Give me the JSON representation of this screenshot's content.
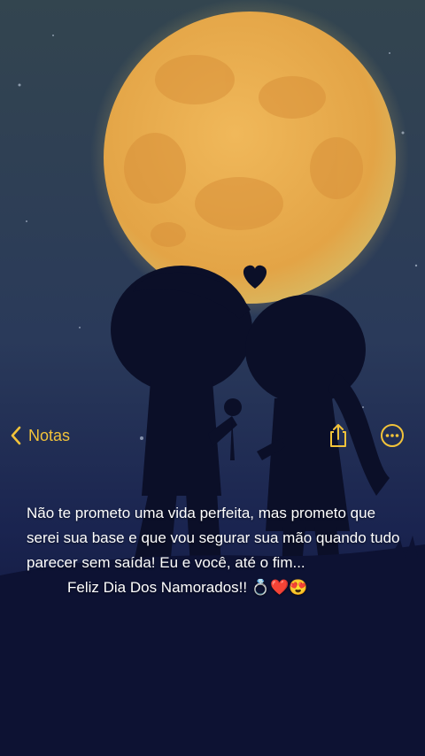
{
  "nav": {
    "back_label": "Notas",
    "back_icon": "chevron-left-icon",
    "share_icon": "share-icon",
    "more_icon": "more-circle-icon",
    "accent_color": "#f2c33a"
  },
  "note": {
    "paragraph": " Não te prometo uma vida perfeita, mas prometo que serei sua base e que vou segurar sua mão quando tudo parecer sem saída! Eu e você, até o fim...",
    "closing": "Feliz Dia Dos Namorados!! 💍❤️😍"
  },
  "background": {
    "description_icon": "moon-couple-wallpaper",
    "moon_color": "#e5a94a",
    "sky_color": "#1c2a55"
  }
}
